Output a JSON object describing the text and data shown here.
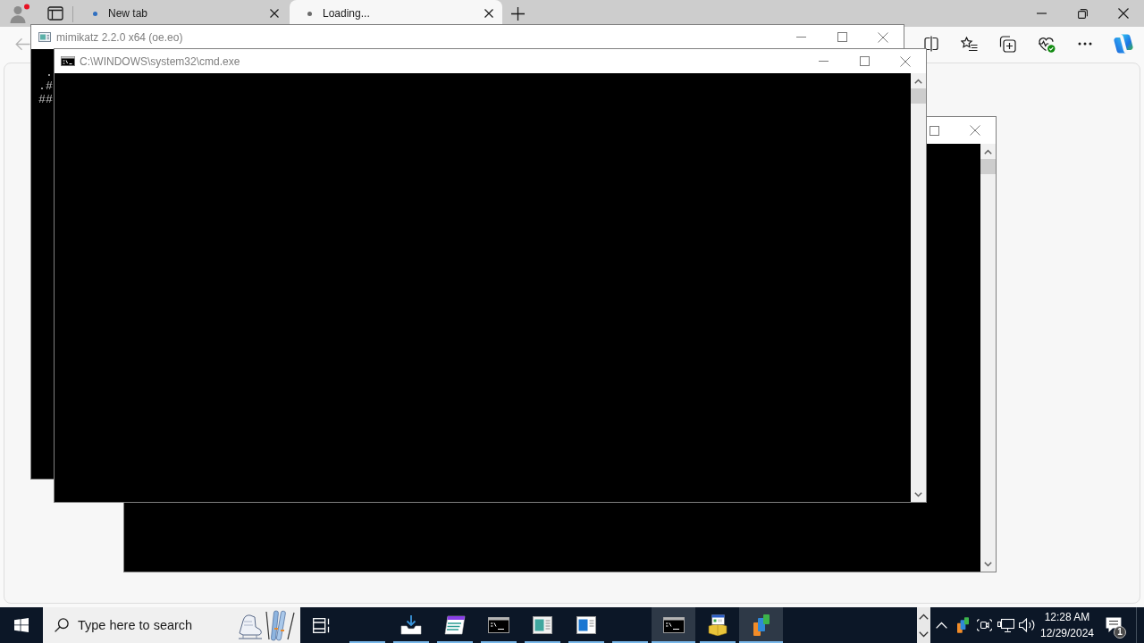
{
  "browser": {
    "tabs": [
      {
        "label": "New tab",
        "selected": false
      },
      {
        "label": "Loading...",
        "selected": true
      }
    ],
    "back_button": {
      "disabled": true
    }
  },
  "mimikatz_window": {
    "title": "mimikatz 2.2.0 x64 (oe.eo)",
    "lines": [
      "  .",
      " .#",
      " ##"
    ]
  },
  "cmd_window": {
    "title": "C:\\WINDOWS\\system32\\cmd.exe"
  },
  "taskbar": {
    "search": {
      "placeholder": "Type here to search"
    },
    "apps": [
      {
        "kind": "blank",
        "running": true,
        "active": false
      },
      {
        "kind": "download",
        "running": true,
        "active": false
      },
      {
        "kind": "editor",
        "running": true,
        "active": false
      },
      {
        "kind": "console",
        "running": true,
        "active": false
      },
      {
        "kind": "panel",
        "running": true,
        "active": false
      },
      {
        "kind": "sidebar",
        "running": true,
        "active": false
      },
      {
        "kind": "blank",
        "running": true,
        "active": false
      },
      {
        "kind": "console",
        "running": true,
        "active": true
      },
      {
        "kind": "package",
        "running": true,
        "active": false
      },
      {
        "kind": "cards",
        "running": true,
        "active": true
      }
    ],
    "clock": {
      "time": "12:28 AM",
      "date": "12/29/2024"
    },
    "notifications": {
      "count": "1"
    }
  }
}
